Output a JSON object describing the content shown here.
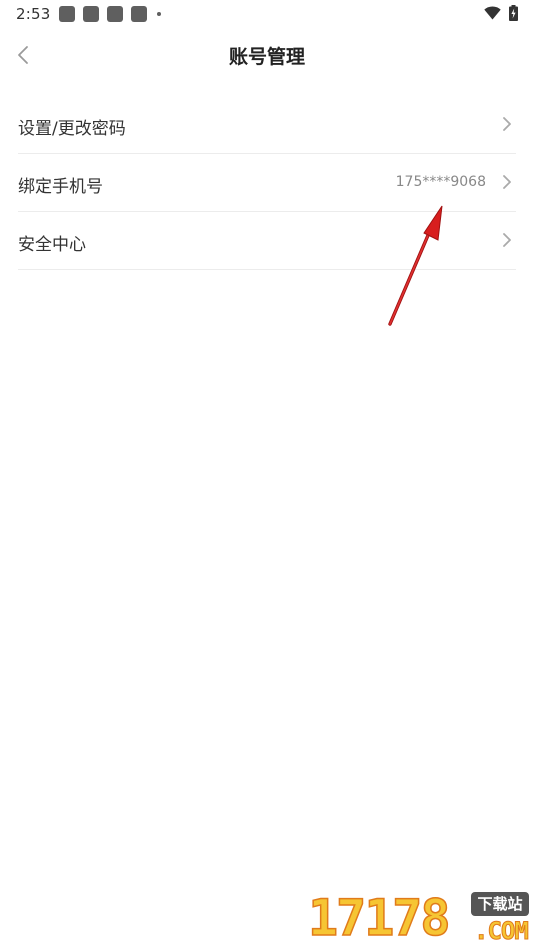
{
  "status_bar": {
    "time": "2:53"
  },
  "header": {
    "title": "账号管理",
    "back_icon": "chevron-left-icon"
  },
  "settings": {
    "items": [
      {
        "label": "设置/更改密码",
        "value": ""
      },
      {
        "label": "绑定手机号",
        "value": "175****9068"
      },
      {
        "label": "安全中心",
        "value": ""
      }
    ]
  },
  "annotation": {
    "arrow_color": "#d81e1e"
  },
  "watermark": {
    "digits": "17178",
    "badge": "下载站",
    "domain": ".COM"
  },
  "colors": {
    "background": "#ffffff",
    "text_primary": "#333333",
    "text_secondary": "#888888",
    "divider": "#ececec",
    "chevron": "#aaaaaa"
  }
}
